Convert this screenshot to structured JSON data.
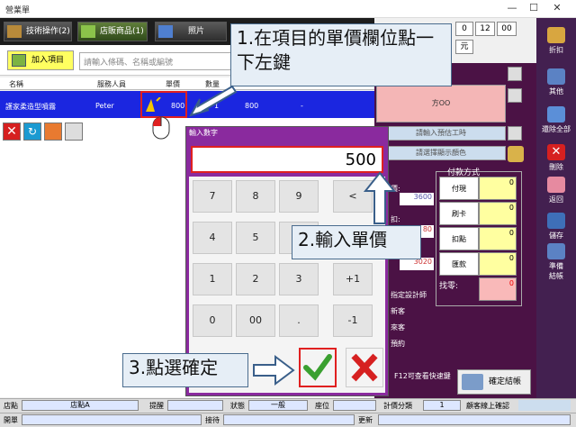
{
  "window": {
    "title": "營業單"
  },
  "tabs": [
    {
      "label": "技術操作(2)"
    },
    {
      "label": "店販商品(1)"
    },
    {
      "label": "照片"
    }
  ],
  "toolbar": {
    "add_label": "加入項目",
    "search_placeholder": "請輸入條碼、名稱或編號"
  },
  "table": {
    "headers": [
      "名稱",
      "服務人員",
      "單價",
      "數量"
    ],
    "row": {
      "name": "護家柔造型噴霧",
      "staff": "Peter",
      "price": "800",
      "qty": "1",
      "total": "800",
      "misc": "-"
    }
  },
  "right_top": {
    "r1": "0",
    "r2": "12",
    "r3": "00",
    "r4": "元"
  },
  "right_panel": {
    "customer": "方OO",
    "enter_time": "請輸入預估工時",
    "select_color": "請選擇顯示顏色",
    "price_label": "價:",
    "price_val": "3600",
    "discount_label": "扣:",
    "discount_val": "80",
    "total_val": "3020",
    "designer": "指定設計師",
    "new_customer": "新客",
    "old_customer": "來客",
    "reserve": "預約",
    "f12_hint": "F12可查看快速鍵",
    "confirm": "確定結帳"
  },
  "payment": {
    "header": "付款方式",
    "items": [
      {
        "label": "付現",
        "value": "0"
      },
      {
        "label": "刷卡",
        "value": "0"
      },
      {
        "label": "扣點",
        "value": "0"
      },
      {
        "label": "匯款",
        "value": "0"
      }
    ],
    "change_label": "找零:",
    "change_value": "0"
  },
  "sidebar": [
    {
      "label": "折扣"
    },
    {
      "label": "其他"
    },
    {
      "label": "還除全部"
    },
    {
      "label": "刪除"
    },
    {
      "label": "返回"
    },
    {
      "label": "儲存"
    },
    {
      "label": "準備\n結帳"
    }
  ],
  "dialog": {
    "title": "輸入數字",
    "value": "500",
    "keys": [
      "7",
      "8",
      "9",
      "<",
      "4",
      "5",
      "6",
      "",
      "1",
      "2",
      "3",
      "+1",
      "0",
      "00",
      ".",
      "-1"
    ]
  },
  "callouts": {
    "step1": "1.在項目的單價欄位點一下左鍵",
    "step2": "2.輸入單價",
    "step3": "3.點選確定"
  },
  "footer": {
    "store_label": "店點",
    "store_val": "店點A",
    "remind_label": "提醒",
    "status_label": "狀態",
    "status_val": "一般",
    "seat_label": "座位",
    "timer_label": "計價分類",
    "timer_val": "1",
    "online_label": "顧客線上確認",
    "open_label": "開單",
    "receive_label": "接待",
    "update_label": "更新"
  }
}
